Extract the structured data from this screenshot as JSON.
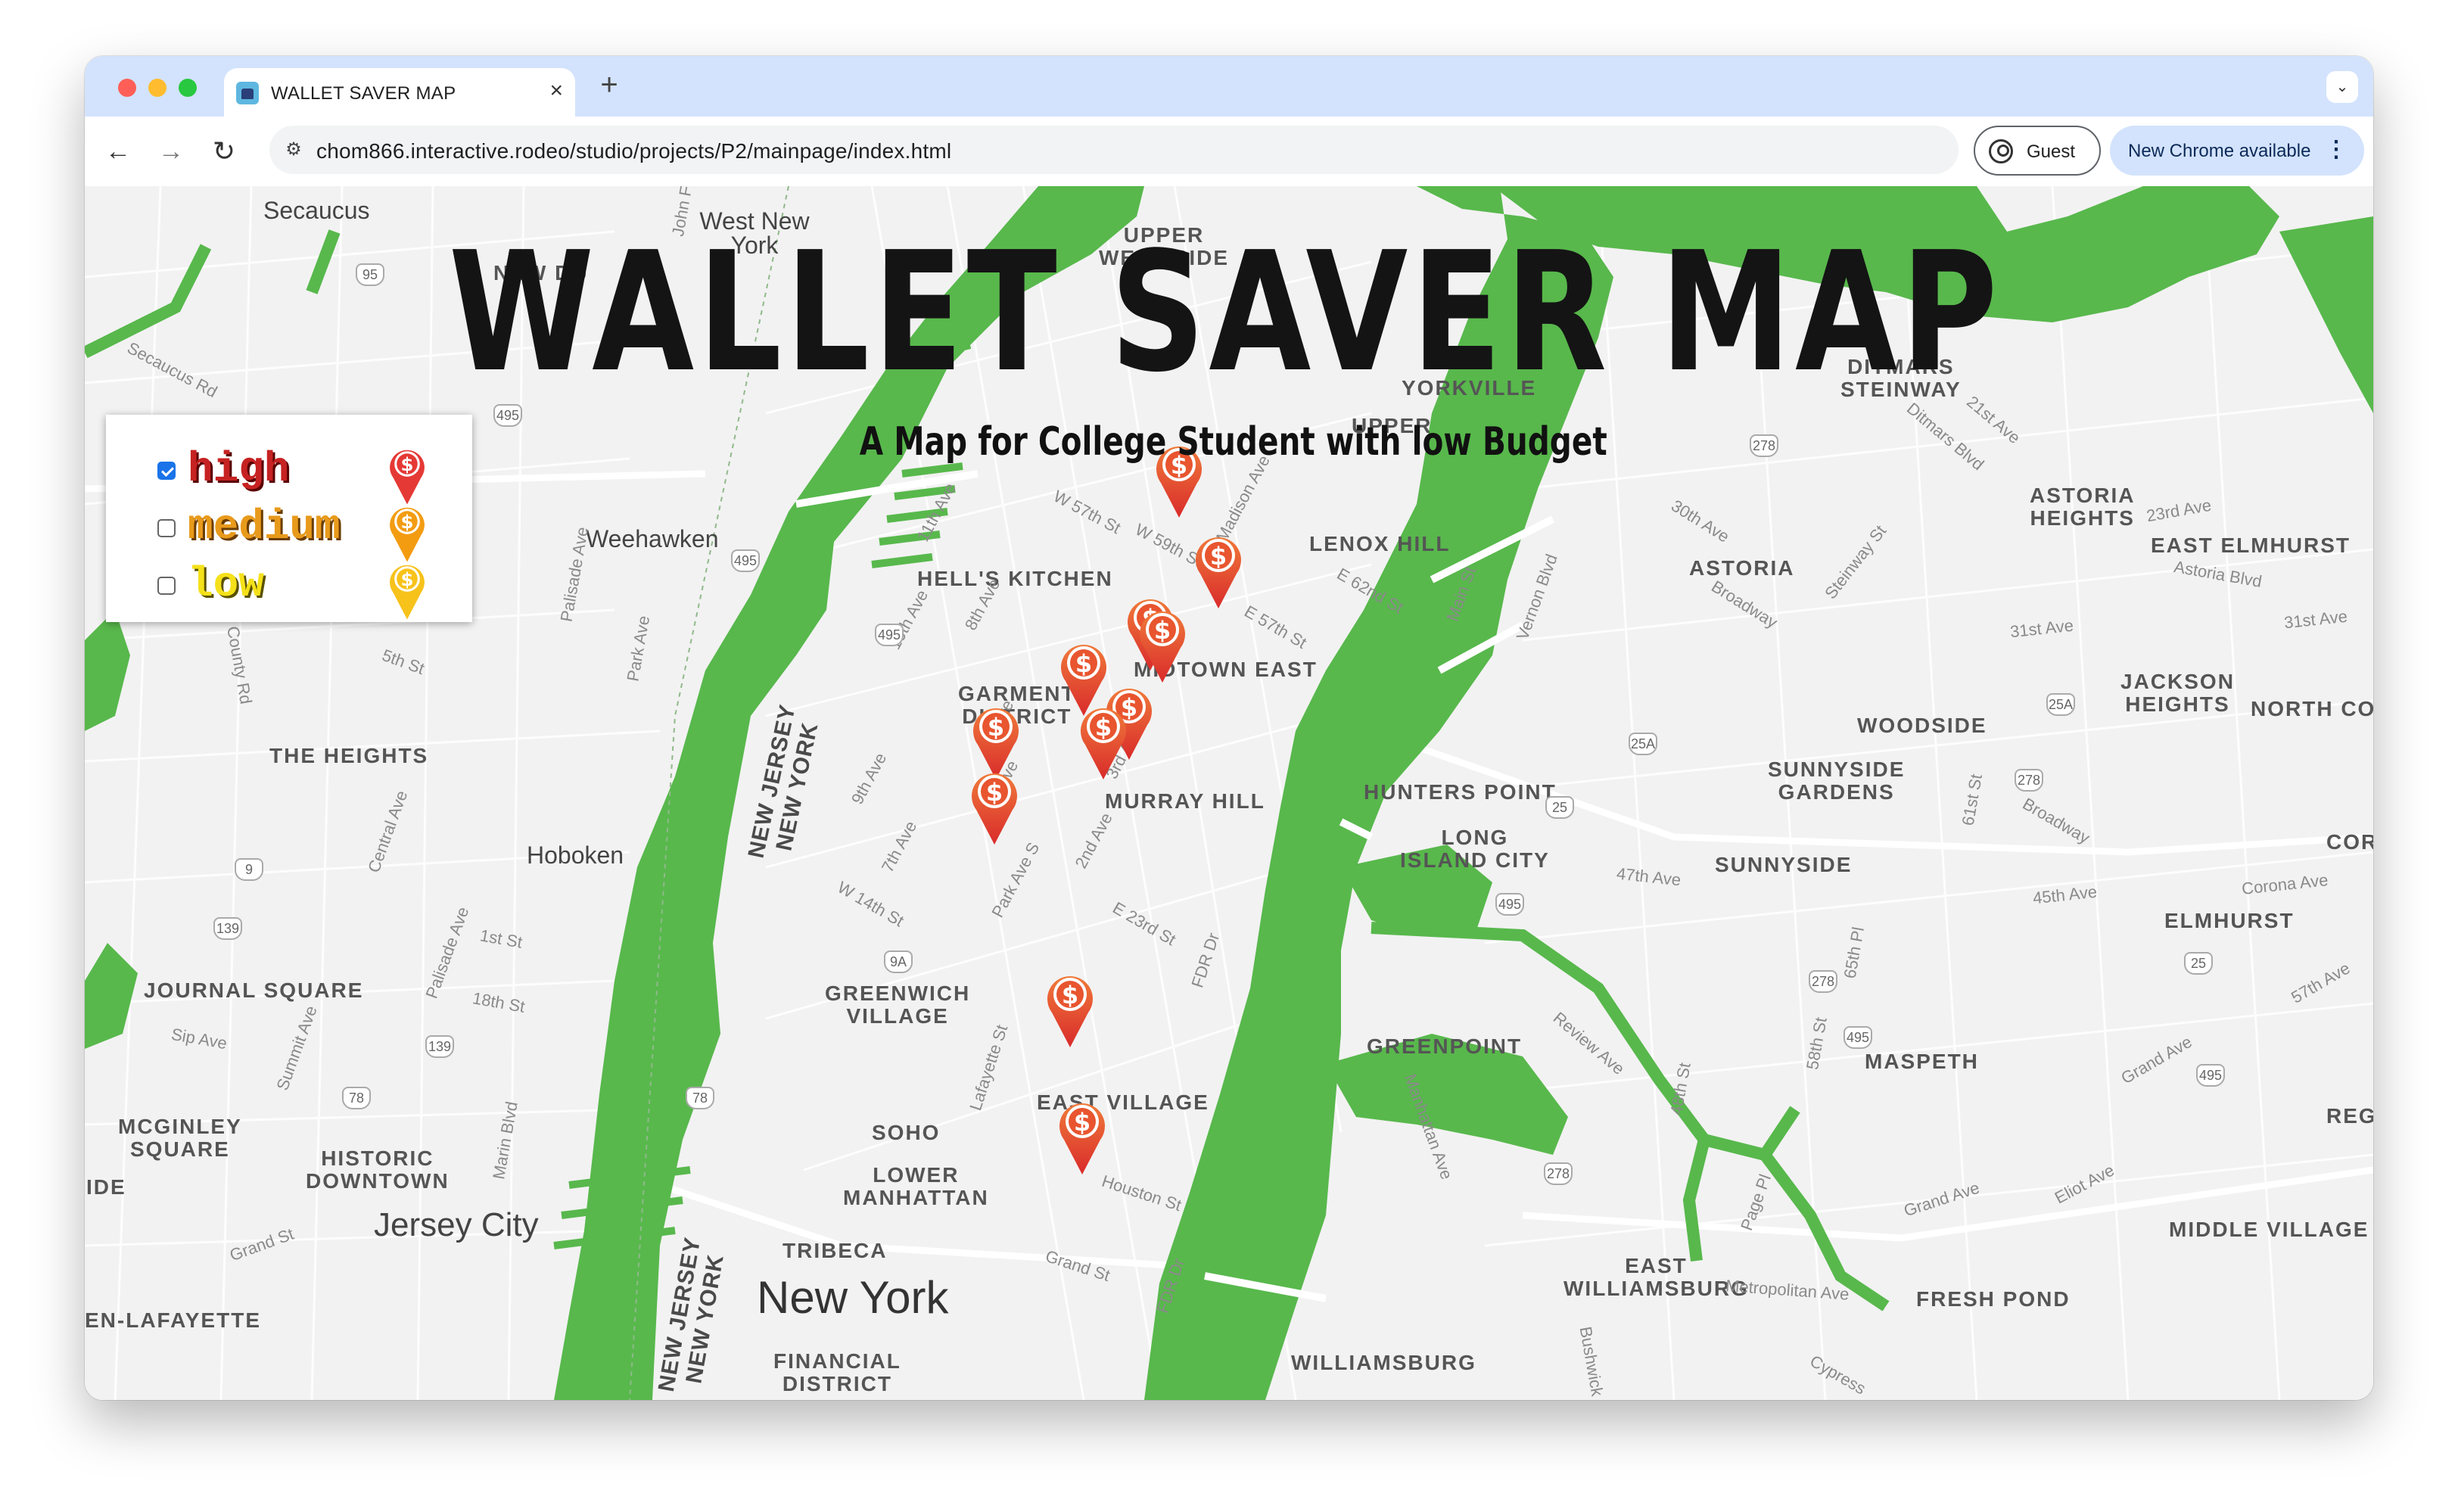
{
  "browser": {
    "tab_title": "WALLET SAVER MAP",
    "tab_close": "×",
    "new_tab": "+",
    "tab_menu": "⌄",
    "back": "←",
    "forward": "→",
    "reload": "↻",
    "site_info": "⚙",
    "url": "chom866.interactive.rodeo/studio/projects/P2/mainpage/index.html",
    "guest_label": "Guest",
    "update_label": "New Chrome available",
    "update_menu": "⋮"
  },
  "page": {
    "title": "WALLET SAVER MAP",
    "subtitle": "A Map for College Student with low Budget"
  },
  "legend": {
    "items": [
      {
        "label": "high",
        "checked": true,
        "color": "#e53935"
      },
      {
        "label": "medium",
        "checked": false,
        "color": "#f39c12"
      },
      {
        "label": "low",
        "checked": false,
        "color": "#f7d11a"
      }
    ]
  },
  "pins": {
    "symbol": "$",
    "count": 11,
    "level": "high"
  },
  "map": {
    "water_color": "#58b84c",
    "land_color": "#f2f2f2",
    "neighborhoods": {
      "secaucus": "Secaucus",
      "west_new_york": "West New\nYork",
      "new_durham": "NEW DU",
      "upper_west_side": "UPPER\nWEST SIDE",
      "upper_east_side": "UPPER",
      "yorkville": "YORKVILLE",
      "ditmars": "DITMARS\nSTEINWAY",
      "astoria_heights": "ASTORIA\nHEIGHTS",
      "east_elmhurst": "EAST ELMHURST",
      "weehawken": "Weehawken",
      "hells_kitchen": "HELL'S KITCHEN",
      "lenox_hill": "LENOX HILL",
      "astoria": "ASTORIA",
      "midtown_east": "MIDTOWN EAST",
      "garment_district": "GARMENT\nDISTRICT",
      "jackson_heights": "JACKSON\nHEIGHTS",
      "north_co": "NORTH CO",
      "woodside": "WOODSIDE",
      "the_heights": "THE HEIGHTS",
      "murray_hill": "MURRAY HILL",
      "hunters_point": "HUNTERS POINT",
      "sunnyside_gardens": "SUNNYSIDE\nGARDENS",
      "long_island_city": "LONG\nISLAND CITY",
      "hoboken": "Hoboken",
      "sunnyside": "SUNNYSIDE",
      "cor": "COR",
      "elmhurst": "ELMHURST",
      "journal_square": "JOURNAL SQUARE",
      "greenwich_village": "GREENWICH\nVILLAGE",
      "greenpoint": "GREENPOINT",
      "maspeth": "MASPETH",
      "reg": "REG",
      "mcginley_square": "MCGINLEY\nSQUARE",
      "east_village": "EAST VILLAGE",
      "soho": "SOHO",
      "historic_downtown": "HISTORIC\nDOWNTOWN",
      "ide": "IDE",
      "lower_manhattan": "LOWER\nMANHATTAN",
      "jersey_city": "Jersey City",
      "middle_village": "MIDDLE VILLAGE",
      "tribeca": "TRIBECA",
      "east_williamsburg": "EAST\nWILLIAMSBURG",
      "new_york": "New York",
      "fresh_pond": "FRESH POND",
      "en_lafayette": "EN-LAFAYETTE",
      "financial_district": "FINANCIAL\nDISTRICT",
      "williamsburg": "WILLIAMSBURG"
    },
    "river_labels": {
      "nj_ny_upper": "NEW JERSEY\nNEW YORK",
      "nj_ny_lower": "NEW JERSEY\nNEW YORK"
    },
    "streets": {
      "secaucus_rd": "Secaucus Rd",
      "w57": "W 57th St",
      "w59": "W 59th St",
      "e62": "E 62nd St",
      "e57": "E 57th St",
      "e23": "E 23rd St",
      "w14": "W 14th St",
      "ave11": "11th Ave",
      "ave10": "10th Ave",
      "ave9": "9th Ave",
      "ave8": "8th Ave",
      "ave7": "7th Ave",
      "ave6": "6th Ave",
      "ave5": "5th Ave",
      "ave3": "3rd Ave",
      "ave2": "2nd Ave",
      "park_ave_s": "Park Ave S",
      "madison": "Madison Ave",
      "fdr": "FDR Dr",
      "lafayette": "Lafayette St",
      "houston": "Houston St",
      "grand_st": "Grand St",
      "ave30": "30th Ave",
      "broadway": "Broadway",
      "steinway": "Steinway St",
      "ditmars_blvd": "Ditmars Blvd",
      "ave21": "21st Ave",
      "ave23": "23rd Ave",
      "astoria_blvd": "Astoria Blvd",
      "ave31": "31st Ave",
      "main_st": "Main St",
      "vernon": "Vernon Blvd",
      "ave47": "47th Ave",
      "st61": "61st St",
      "ave45": "45th Ave",
      "corona": "Corona Ave",
      "ave57": "57th Ave",
      "review": "Review Ave",
      "st58": "58th St",
      "pl65": "65th Pl",
      "grand_ave": "Grand Ave",
      "eliot": "Eliot Ave",
      "metropolitan": "Metropolitan Ave",
      "manhattan_ave": "Manhattan Ave",
      "page_pl": "Page Pl",
      "st48": "48th St",
      "palisade": "Palisade Ave",
      "park_ave_nj": "Park Ave",
      "county_rd": "County Rd",
      "st5": "5th St",
      "central": "Central Ave",
      "st1": "1st St",
      "st18": "18th St",
      "sip": "Sip Ave",
      "summit": "Summit Ave",
      "marin": "Marin Blvd",
      "grand_st_nj": "Grand St",
      "bushwick": "Bushwick",
      "cypress": "Cypress",
      "john_f": "John F"
    },
    "shields": [
      "95",
      "495",
      "495",
      "495",
      "9A",
      "9A",
      "25A",
      "25",
      "25A",
      "278",
      "278",
      "278",
      "278",
      "495",
      "495",
      "9",
      "139",
      "139",
      "78",
      "78",
      "278",
      "25",
      "495"
    ]
  }
}
